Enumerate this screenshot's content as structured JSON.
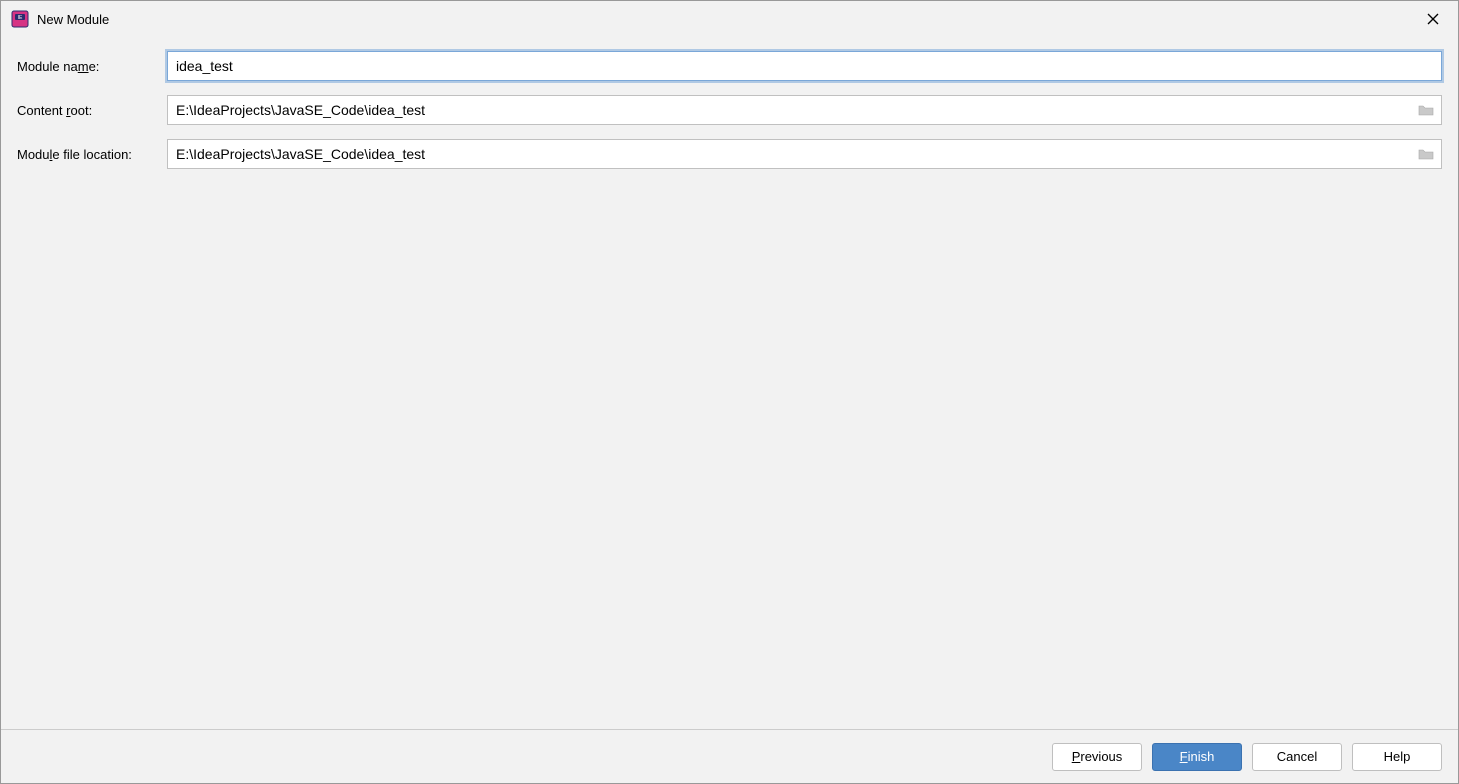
{
  "titlebar": {
    "title": "New Module"
  },
  "form": {
    "moduleName": {
      "labelPrefix": "Module na",
      "labelMnemonic": "m",
      "labelSuffix": "e:",
      "value": "idea_test"
    },
    "contentRoot": {
      "labelPrefix": "Content ",
      "labelMnemonic": "r",
      "labelSuffix": "oot:",
      "value": "E:\\IdeaProjects\\JavaSE_Code\\idea_test"
    },
    "moduleFileLocation": {
      "labelPrefix": "Modu",
      "labelMnemonic": "l",
      "labelSuffix": "e file location:",
      "value": "E:\\IdeaProjects\\JavaSE_Code\\idea_test"
    }
  },
  "buttons": {
    "previous": {
      "mnemonic": "P",
      "rest": "revious"
    },
    "finish": {
      "mnemonic": "F",
      "rest": "inish"
    },
    "cancel": {
      "text": "Cancel"
    },
    "help": {
      "text": "Help"
    }
  }
}
